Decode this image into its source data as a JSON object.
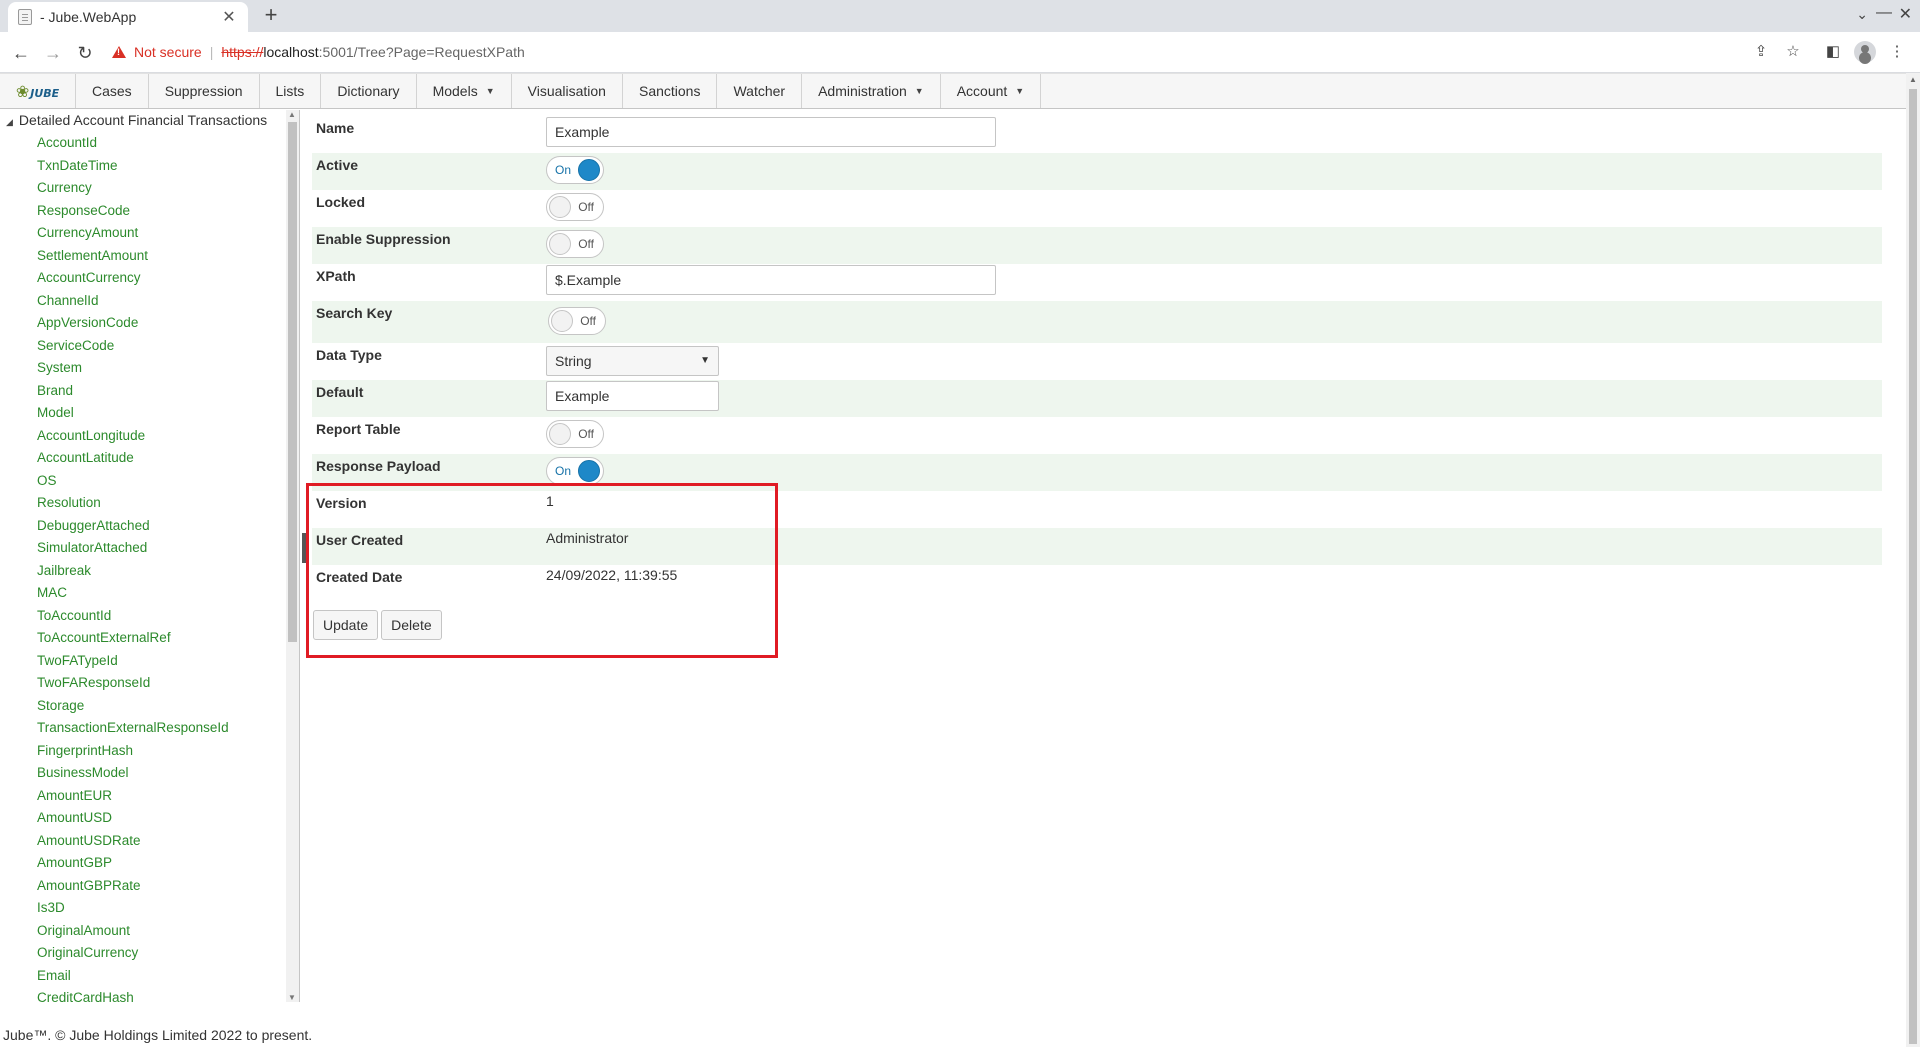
{
  "browser": {
    "tab_title": "- Jube.WebApp",
    "new_tab": "+",
    "not_secure": "Not secure",
    "url_scheme": "https://",
    "url_host": "localhost",
    "url_path": ":5001/Tree?Page=RequestXPath"
  },
  "nav": {
    "logo_text": "JUBE",
    "items": [
      {
        "label": "Cases"
      },
      {
        "label": "Suppression"
      },
      {
        "label": "Lists"
      },
      {
        "label": "Dictionary"
      },
      {
        "label": "Models",
        "dropdown": true
      },
      {
        "label": "Visualisation"
      },
      {
        "label": "Sanctions"
      },
      {
        "label": "Watcher"
      },
      {
        "label": "Administration",
        "dropdown": true
      },
      {
        "label": "Account",
        "dropdown": true
      }
    ]
  },
  "tree": {
    "root": "Detailed Account Financial Transactions",
    "items": [
      "AccountId",
      "TxnDateTime",
      "Currency",
      "ResponseCode",
      "CurrencyAmount",
      "SettlementAmount",
      "AccountCurrency",
      "ChannelId",
      "AppVersionCode",
      "ServiceCode",
      "System",
      "Brand",
      "Model",
      "AccountLongitude",
      "AccountLatitude",
      "OS",
      "Resolution",
      "DebuggerAttached",
      "SimulatorAttached",
      "Jailbreak",
      "MAC",
      "ToAccountId",
      "ToAccountExternalRef",
      "TwoFATypeId",
      "TwoFAResponseId",
      "Storage",
      "TransactionExternalResponseId",
      "FingerprintHash",
      "BusinessModel",
      "AmountEUR",
      "AmountUSD",
      "AmountUSDRate",
      "AmountGBP",
      "AmountGBPRate",
      "Is3D",
      "OriginalAmount",
      "OriginalCurrency",
      "Email",
      "CreditCardHash"
    ]
  },
  "form": {
    "name_label": "Name",
    "name_value": "Example",
    "active_label": "Active",
    "active_state": "On",
    "locked_label": "Locked",
    "locked_state": "Off",
    "suppression_label": "Enable Suppression",
    "suppression_state": "Off",
    "xpath_label": "XPath",
    "xpath_value": "$.Example",
    "searchkey_label": "Search Key",
    "searchkey_state": "Off",
    "datatype_label": "Data Type",
    "datatype_value": "String",
    "default_label": "Default",
    "default_value": "Example",
    "reporttable_label": "Report Table",
    "reporttable_state": "Off",
    "responsepayload_label": "Response Payload",
    "responsepayload_state": "On",
    "version_label": "Version",
    "version_value": "1",
    "usercreated_label": "User Created",
    "usercreated_value": "Administrator",
    "createddate_label": "Created Date",
    "createddate_value": "24/09/2022, 11:39:55",
    "update_button": "Update",
    "delete_button": "Delete"
  },
  "footer": "Jube™. © Jube Holdings Limited 2022 to present.",
  "colors": {
    "highlight": "#e01b24",
    "tree_link": "#2c8a2c",
    "toggle_on": "#1e88c8"
  }
}
